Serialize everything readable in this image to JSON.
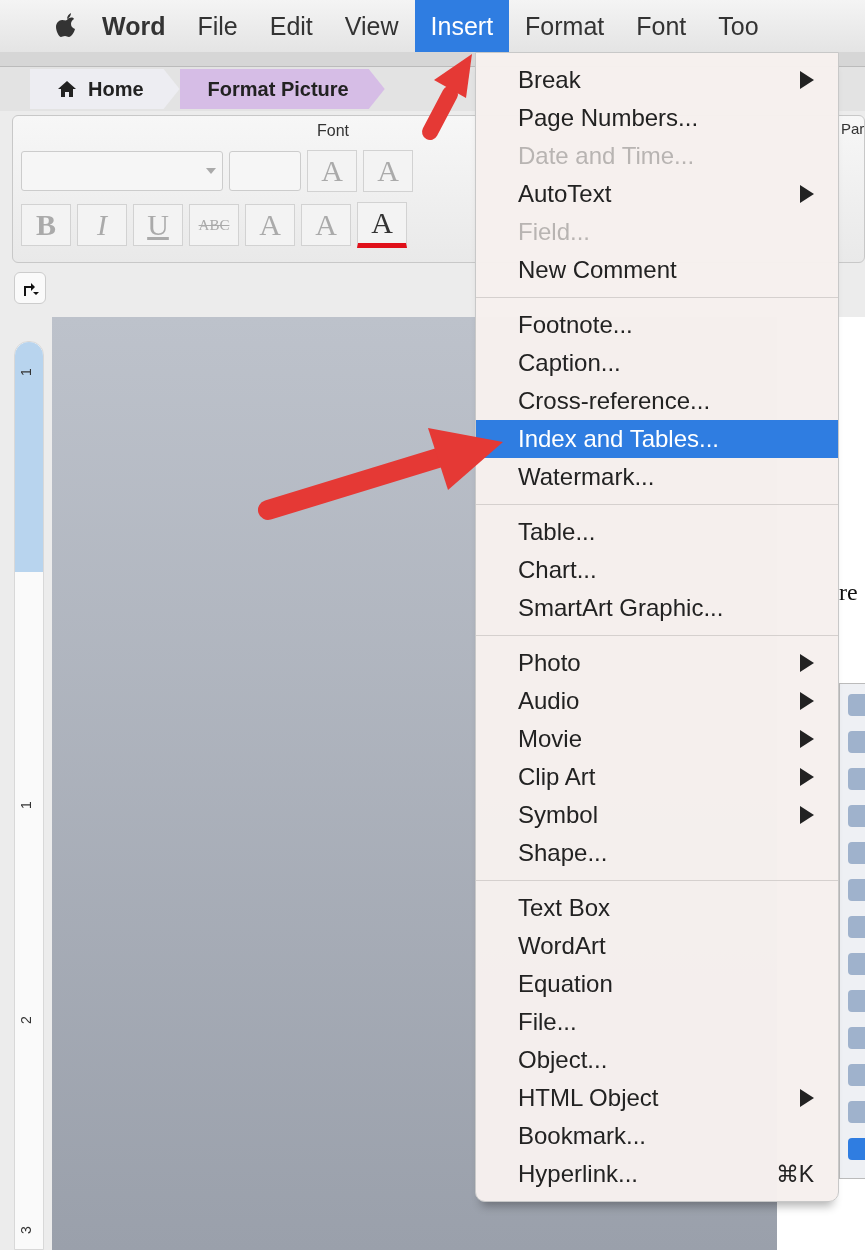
{
  "menu_bar": {
    "items": [
      {
        "label": "Word",
        "kind": "app",
        "selected": false
      },
      {
        "label": "File",
        "kind": "menu",
        "selected": false
      },
      {
        "label": "Edit",
        "kind": "menu",
        "selected": false
      },
      {
        "label": "View",
        "kind": "menu",
        "selected": false
      },
      {
        "label": "Insert",
        "kind": "menu",
        "selected": true
      },
      {
        "label": "Format",
        "kind": "menu",
        "selected": false
      },
      {
        "label": "Font",
        "kind": "menu",
        "selected": false
      },
      {
        "label": "Too",
        "kind": "menu",
        "selected": false
      }
    ]
  },
  "ribbon": {
    "tabs": [
      {
        "label": "Home",
        "selected": false
      },
      {
        "label": "Format Picture",
        "selected": true
      }
    ],
    "group_label": "Font",
    "side_label": "Par",
    "size_buttons": [
      "A",
      "A"
    ],
    "format_buttons": [
      {
        "label": "B",
        "kind": "bold"
      },
      {
        "label": "I",
        "kind": "italic"
      },
      {
        "label": "U",
        "kind": "underline"
      },
      {
        "label": "ABC",
        "kind": "strike"
      },
      {
        "label": "A",
        "kind": "plain"
      },
      {
        "label": "A",
        "kind": "subscript"
      },
      {
        "label": "A",
        "kind": "color"
      }
    ]
  },
  "ruler": {
    "labels": [
      "1",
      "1",
      "2",
      "3"
    ]
  },
  "document": {
    "text": "re"
  },
  "insert_menu": {
    "groups": [
      [
        {
          "label": "Break",
          "submenu": true,
          "disabled": false,
          "selected": false
        },
        {
          "label": "Page Numbers...",
          "submenu": false,
          "disabled": false,
          "selected": false
        },
        {
          "label": "Date and Time...",
          "submenu": false,
          "disabled": true,
          "selected": false
        },
        {
          "label": "AutoText",
          "submenu": true,
          "disabled": false,
          "selected": false
        },
        {
          "label": "Field...",
          "submenu": false,
          "disabled": true,
          "selected": false
        },
        {
          "label": "New Comment",
          "submenu": false,
          "disabled": false,
          "selected": false
        }
      ],
      [
        {
          "label": "Footnote...",
          "submenu": false,
          "disabled": false,
          "selected": false
        },
        {
          "label": "Caption...",
          "submenu": false,
          "disabled": false,
          "selected": false
        },
        {
          "label": "Cross-reference...",
          "submenu": false,
          "disabled": false,
          "selected": false
        },
        {
          "label": "Index and Tables...",
          "submenu": false,
          "disabled": false,
          "selected": true
        },
        {
          "label": "Watermark...",
          "submenu": false,
          "disabled": false,
          "selected": false
        }
      ],
      [
        {
          "label": "Table...",
          "submenu": false,
          "disabled": false,
          "selected": false
        },
        {
          "label": "Chart...",
          "submenu": false,
          "disabled": false,
          "selected": false
        },
        {
          "label": "SmartArt Graphic...",
          "submenu": false,
          "disabled": false,
          "selected": false
        }
      ],
      [
        {
          "label": "Photo",
          "submenu": true,
          "disabled": false,
          "selected": false
        },
        {
          "label": "Audio",
          "submenu": true,
          "disabled": false,
          "selected": false
        },
        {
          "label": "Movie",
          "submenu": true,
          "disabled": false,
          "selected": false
        },
        {
          "label": "Clip Art",
          "submenu": true,
          "disabled": false,
          "selected": false
        },
        {
          "label": "Symbol",
          "submenu": true,
          "disabled": false,
          "selected": false
        },
        {
          "label": "Shape...",
          "submenu": false,
          "disabled": false,
          "selected": false
        }
      ],
      [
        {
          "label": "Text Box",
          "submenu": false,
          "disabled": false,
          "selected": false
        },
        {
          "label": "WordArt",
          "submenu": false,
          "disabled": false,
          "selected": false
        },
        {
          "label": "Equation",
          "submenu": false,
          "disabled": false,
          "selected": false
        },
        {
          "label": "File...",
          "submenu": false,
          "disabled": false,
          "selected": false
        },
        {
          "label": "Object...",
          "submenu": false,
          "disabled": false,
          "selected": false
        },
        {
          "label": "HTML Object",
          "submenu": true,
          "disabled": false,
          "selected": false
        },
        {
          "label": "Bookmark...",
          "submenu": false,
          "disabled": false,
          "selected": false
        },
        {
          "label": "Hyperlink...",
          "submenu": false,
          "disabled": false,
          "selected": false,
          "shortcut": "⌘K"
        }
      ]
    ]
  }
}
